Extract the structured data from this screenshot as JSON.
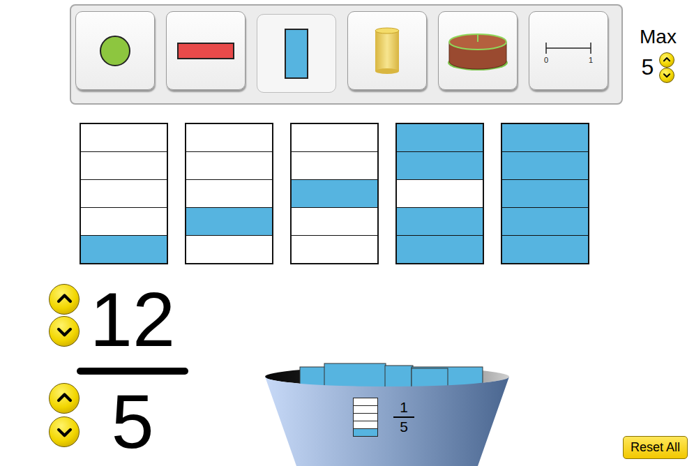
{
  "toolbar": {
    "items": [
      {
        "kind": "circle",
        "selected": false
      },
      {
        "kind": "horizontal-bar",
        "selected": false
      },
      {
        "kind": "vertical-bar",
        "selected": true
      },
      {
        "kind": "cylinder",
        "selected": false
      },
      {
        "kind": "cake",
        "selected": false
      },
      {
        "kind": "number-line",
        "selected": false,
        "start": "0",
        "end": "1"
      }
    ]
  },
  "max": {
    "label": "Max",
    "value": "5"
  },
  "containers": [
    {
      "cells": [
        {
          "filled": false
        },
        {
          "filled": false
        },
        {
          "filled": false
        },
        {
          "filled": false
        },
        {
          "filled": true
        }
      ]
    },
    {
      "cells": [
        {
          "filled": false
        },
        {
          "filled": false
        },
        {
          "filled": false
        },
        {
          "filled": true
        },
        {
          "filled": false
        }
      ]
    },
    {
      "cells": [
        {
          "filled": false
        },
        {
          "filled": false
        },
        {
          "filled": true
        },
        {
          "filled": false
        },
        {
          "filled": false
        }
      ]
    },
    {
      "cells": [
        {
          "filled": true
        },
        {
          "filled": true
        },
        {
          "filled": false
        },
        {
          "filled": true
        },
        {
          "filled": true
        }
      ]
    },
    {
      "cells": [
        {
          "filled": true
        },
        {
          "filled": true
        },
        {
          "filled": true
        },
        {
          "filled": true
        },
        {
          "filled": true
        }
      ]
    }
  ],
  "fraction": {
    "numerator": "12",
    "denominator": "5"
  },
  "bucket": {
    "numerator": "1",
    "denominator": "5",
    "cells": [
      {
        "filled": false
      },
      {
        "filled": false
      },
      {
        "filled": false
      },
      {
        "filled": false
      },
      {
        "filled": true
      }
    ]
  },
  "reset_button": {
    "label": "Reset All"
  }
}
